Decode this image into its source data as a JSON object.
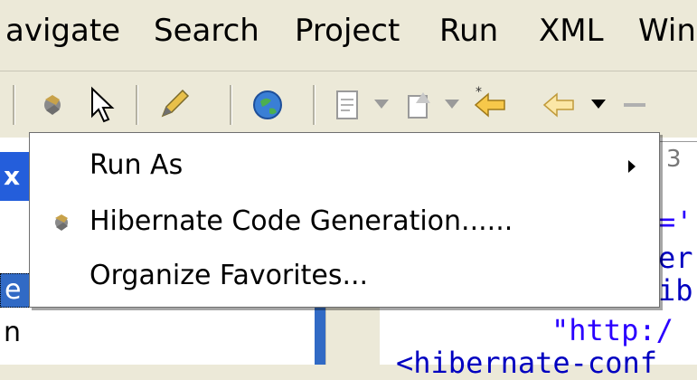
{
  "menubar": {
    "items": [
      {
        "label": "avigate"
      },
      {
        "label": "Search"
      },
      {
        "label": "Project"
      },
      {
        "label": "Run"
      },
      {
        "label": "XML"
      },
      {
        "label": "Win"
      }
    ]
  },
  "toolbar": {
    "icons": [
      "hibernate-icon",
      "pointer-icon",
      "pencil-icon",
      "globe-icon",
      "new-file-icon",
      "open-file-icon",
      "back-arrow-icon",
      "forward-arrow-icon"
    ]
  },
  "left_panel": {
    "tab_glyph": "x",
    "selected_text": "e",
    "row2_text": "n"
  },
  "editor": {
    "tab_glyph": "3",
    "code_lines": [
      "='",
      "er",
      "ib",
      "\"http:/",
      "<hibernate-conf"
    ]
  },
  "popup": {
    "items": [
      {
        "label": "Run As",
        "has_submenu": true
      },
      {
        "label": "Hibernate Code Generation......",
        "icon": "hibernate-icon"
      },
      {
        "label": "Organize Favorites..."
      }
    ]
  },
  "colors": {
    "background": "#ece9d8",
    "selection": "#316ac5",
    "code_blue": "#0000c0",
    "code_teal": "#2a00ff"
  }
}
